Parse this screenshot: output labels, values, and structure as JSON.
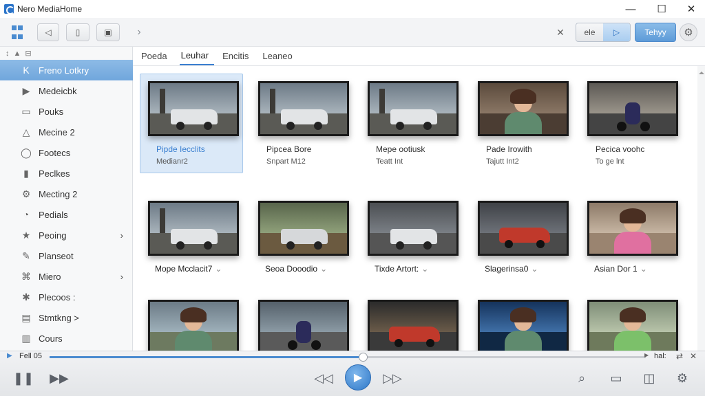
{
  "window": {
    "title": "Nero MediaHome",
    "controls": {
      "minimize": "—",
      "maximize": "☐",
      "close": "✕"
    }
  },
  "toolbar": {
    "small_label": "ele",
    "action_label": "Tehyy",
    "icons": [
      "grid-icon",
      "tag-icon",
      "square-icon",
      "tv-icon",
      "chevron-right-icon",
      "collapse-icon",
      "play-icon",
      "gear-icon"
    ]
  },
  "sidebar": {
    "tools": [
      "↕",
      "▲",
      "⊟"
    ],
    "items": [
      {
        "label": "Freno Lotkry",
        "icon": "K",
        "active": true
      },
      {
        "label": "Medeicbk",
        "icon": "▶"
      },
      {
        "label": "Pouks",
        "icon": "▭"
      },
      {
        "label": "Mecine 2",
        "icon": "△"
      },
      {
        "label": "Footecs",
        "icon": "◯"
      },
      {
        "label": "Peclkes",
        "icon": "▮"
      },
      {
        "label": "Mecting 2",
        "icon": "⚙"
      },
      {
        "label": "Pedials",
        "icon": "◔"
      },
      {
        "label": "Peoing",
        "icon": "★",
        "chevron": true
      },
      {
        "label": "Planseot",
        "icon": "✎"
      },
      {
        "label": "Miero",
        "icon": "⌘",
        "chevron": true
      },
      {
        "label": "Plecoos :",
        "icon": "✱"
      },
      {
        "label": "Stmtkng >",
        "icon": "▤"
      },
      {
        "label": "Cours",
        "icon": "▥"
      }
    ]
  },
  "tabs": [
    {
      "label": "Poeda",
      "active": false
    },
    {
      "label": "Leuhar",
      "active": true
    },
    {
      "label": "Encitis",
      "active": false
    },
    {
      "label": "Leaneo",
      "active": false
    }
  ],
  "grid": {
    "row1": [
      {
        "title": "Pipde Iecclits",
        "subtitle": "Medianr2",
        "selected": true,
        "scene": "truck"
      },
      {
        "title": "Pipcea Bore",
        "subtitle": "Snpart M12",
        "scene": "truck"
      },
      {
        "title": "Mepe ootiusk",
        "subtitle": "Teatt Int",
        "scene": "truck"
      },
      {
        "title": "Pade Irowith",
        "subtitle": "Tajutt Int2",
        "scene": "woman-street"
      },
      {
        "title": "Pecica voohc",
        "subtitle": "To ge lnt",
        "scene": "rider"
      }
    ],
    "row2": [
      {
        "title": "Mope Mcclacit7",
        "scene": "truck"
      },
      {
        "title": "Seoa Dooodio",
        "scene": "car-silver"
      },
      {
        "title": "Tixde Artort:",
        "scene": "truck-garage"
      },
      {
        "title": "Slagerinsa0",
        "scene": "car-red-garage"
      },
      {
        "title": "Asian Dor 1",
        "scene": "woman-portrait"
      }
    ],
    "row3": [
      {
        "scene": "woman-field"
      },
      {
        "scene": "rider-road"
      },
      {
        "scene": "car-red"
      },
      {
        "scene": "woman-blue"
      },
      {
        "scene": "woman-smile"
      }
    ]
  },
  "player": {
    "now_playing": "Fell 05",
    "time": "hal:",
    "progress": 0.525,
    "controls": [
      "pause-icon",
      "fast-forward-icon",
      "rewind-icon",
      "play-icon",
      "skip-icon",
      "search-icon",
      "screen-icon",
      "chat-icon",
      "gear-icon"
    ]
  }
}
